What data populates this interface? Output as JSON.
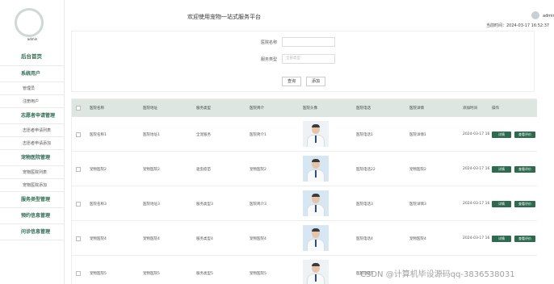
{
  "header": {
    "title": "欢迎使用宠物一站式服务平台",
    "user": "admin",
    "time": "当前时间：2024-03-17 16:52:37"
  },
  "sidebar": {
    "logo_label": "admin",
    "items": [
      {
        "label": "后台首页",
        "kind": "top"
      },
      {
        "label": "系统用户",
        "kind": "grp"
      },
      {
        "label": "管理员",
        "kind": "sub"
      },
      {
        "label": "注册用户",
        "kind": "sub"
      },
      {
        "label": "志愿者申请管理",
        "kind": "grp"
      },
      {
        "label": "志愿者申请列表",
        "kind": "sub"
      },
      {
        "label": "志愿者申请添加",
        "kind": "sub"
      },
      {
        "label": "宠物医院管理",
        "kind": "grp"
      },
      {
        "label": "宠物医院列表",
        "kind": "sub"
      },
      {
        "label": "宠物医院添加",
        "kind": "sub"
      },
      {
        "label": "服务类型管理",
        "kind": "grp"
      },
      {
        "label": "预约信息管理",
        "kind": "grp"
      },
      {
        "label": "问诊信息管理",
        "kind": "grp"
      }
    ]
  },
  "search": {
    "name_label": "医院名称",
    "name_placeholder": "",
    "type_label": "服务类型",
    "type_placeholder": "全部类型",
    "query_button": "查询",
    "add_button": "添加"
  },
  "table": {
    "headers": [
      "医院名称",
      "医院地址",
      "服务类型",
      "医院简介",
      "医院头像",
      "医院电话",
      "医院详情",
      "添加时间",
      "操作"
    ],
    "rows": [
      {
        "cells": [
          "医院名称1",
          "医院地址1",
          "全宠服务",
          "医院简介1",
          "",
          "医院电话1",
          "医院详情1",
          "2024-03-17 16"
        ],
        "photo": "light"
      },
      {
        "cells": [
          "宠物医院2",
          "宠物医院2",
          "驱虫疫苗",
          "宠物医院2",
          "",
          "医院电话22",
          "宠物医院2",
          "2024-03-17 16"
        ],
        "photo": "blue"
      },
      {
        "cells": [
          "医院名称3",
          "医院地址3",
          "服务类型3",
          "医院简介3",
          "",
          "医院电话3",
          "医院详情3",
          "2024-03-17 16"
        ],
        "photo": "blue"
      },
      {
        "cells": [
          "宠物医院4",
          "宠物医院4",
          "服务类型4",
          "宠物医院4",
          "",
          "医院电话4",
          "宠物医院4",
          "2024-03-17 16"
        ],
        "photo": "blue"
      },
      {
        "cells": [
          "宠物医院5",
          "宠物医院5",
          "服务类型5",
          "宠物医院5",
          "",
          "医院电话5",
          "",
          ""
        ],
        "photo": "light"
      }
    ],
    "actions": {
      "edit": "详情",
      "view": "查看评价"
    }
  },
  "watermark": "CSDN @计算机毕设源码qq-3836538031",
  "colors": {
    "accent": "#2e6a4f",
    "table_header": "#dde6e1"
  }
}
